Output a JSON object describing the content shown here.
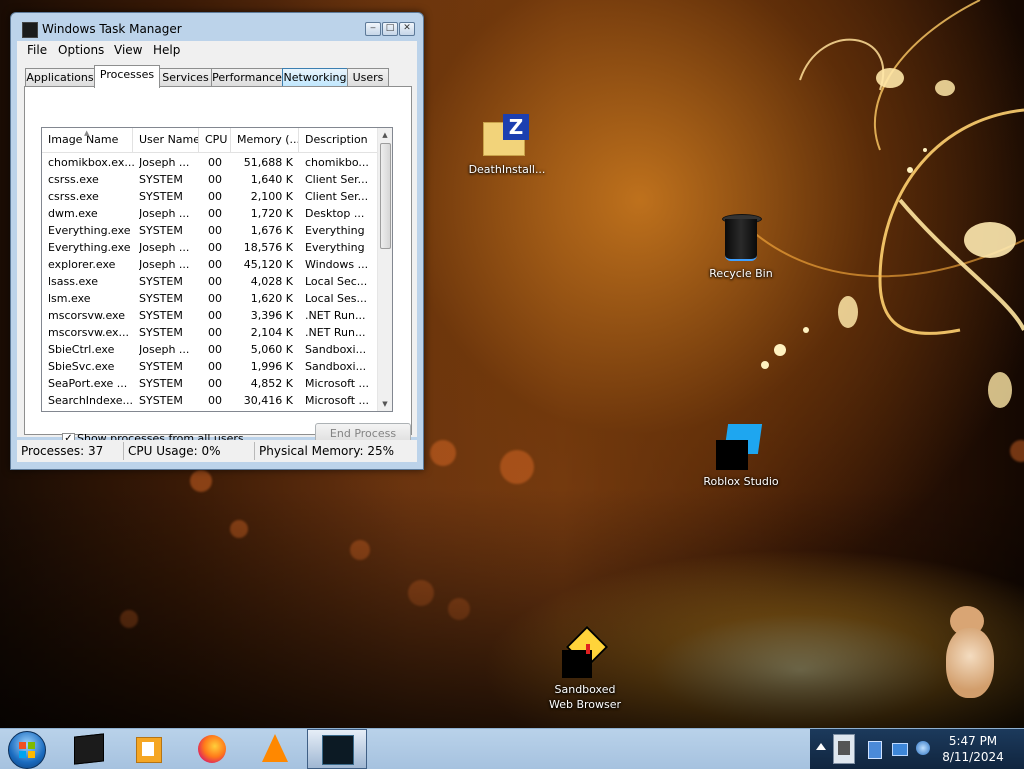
{
  "window": {
    "title": "Windows Task Manager",
    "minimize_glyph": "‒",
    "maximize_glyph": "□",
    "close_glyph": "✕"
  },
  "menu": [
    "File",
    "Options",
    "View",
    "Help"
  ],
  "tabs": [
    "Applications",
    "Processes",
    "Services",
    "Performance",
    "Networking",
    "Users"
  ],
  "active_tab": "Processes",
  "columns": [
    "Image Name",
    "User Name",
    "CPU",
    "Memory (...",
    "Description"
  ],
  "processes": [
    [
      "chomikbox.ex...",
      "Joseph ...",
      "00",
      "51,688 K",
      "chomikbo..."
    ],
    [
      "csrss.exe",
      "SYSTEM",
      "00",
      "1,640 K",
      "Client Ser..."
    ],
    [
      "csrss.exe",
      "SYSTEM",
      "00",
      "2,100 K",
      "Client Ser..."
    ],
    [
      "dwm.exe",
      "Joseph ...",
      "00",
      "1,720 K",
      "Desktop ..."
    ],
    [
      "Everything.exe",
      "SYSTEM",
      "00",
      "1,676 K",
      "Everything"
    ],
    [
      "Everything.exe",
      "Joseph ...",
      "00",
      "18,576 K",
      "Everything"
    ],
    [
      "explorer.exe",
      "Joseph ...",
      "00",
      "45,120 K",
      "Windows ..."
    ],
    [
      "lsass.exe",
      "SYSTEM",
      "00",
      "4,028 K",
      "Local Sec..."
    ],
    [
      "lsm.exe",
      "SYSTEM",
      "00",
      "1,620 K",
      "Local Ses..."
    ],
    [
      "mscorsvw.exe",
      "SYSTEM",
      "00",
      "3,396 K",
      ".NET Run..."
    ],
    [
      "mscorsvw.ex...",
      "SYSTEM",
      "00",
      "2,104 K",
      ".NET Run..."
    ],
    [
      "SbieCtrl.exe",
      "Joseph ...",
      "00",
      "5,060 K",
      "Sandboxi..."
    ],
    [
      "SbieSvc.exe",
      "SYSTEM",
      "00",
      "1,996 K",
      "Sandboxi..."
    ],
    [
      "SeaPort.exe ...",
      "SYSTEM",
      "00",
      "4,852 K",
      "Microsoft ..."
    ],
    [
      "SearchIndexe...",
      "SYSTEM",
      "00",
      "30,416 K",
      "Microsoft ..."
    ]
  ],
  "show_all_users": {
    "label": "Show processes from all users",
    "checked": true,
    "glyph": "✓"
  },
  "end_process_label": "End Process",
  "status": {
    "processes": "Processes: 37",
    "cpu": "CPU Usage: 0%",
    "memory": "Physical Memory: 25%"
  },
  "desktop_icons": {
    "death_installer": "DeathInstall...",
    "recycle_bin": "Recycle Bin",
    "roblox_studio": "Roblox Studio",
    "sandboxed_browser_line1": "Sandboxed",
    "sandboxed_browser_line2": "Web Browser"
  },
  "taskbar": {
    "pinned": [
      "terminal-icon",
      "media-player-icon",
      "firefox-icon",
      "vlc-icon",
      "task-manager-icon"
    ],
    "clock_time": "5:47 PM",
    "clock_date": "8/11/2024",
    "tray_icons": [
      "action-center-icon",
      "network-icon",
      "volume-icon"
    ]
  },
  "colors": {
    "titlebar": "#bcd3ea",
    "taskbar": "#a6c2df",
    "tray": "#10253f"
  }
}
